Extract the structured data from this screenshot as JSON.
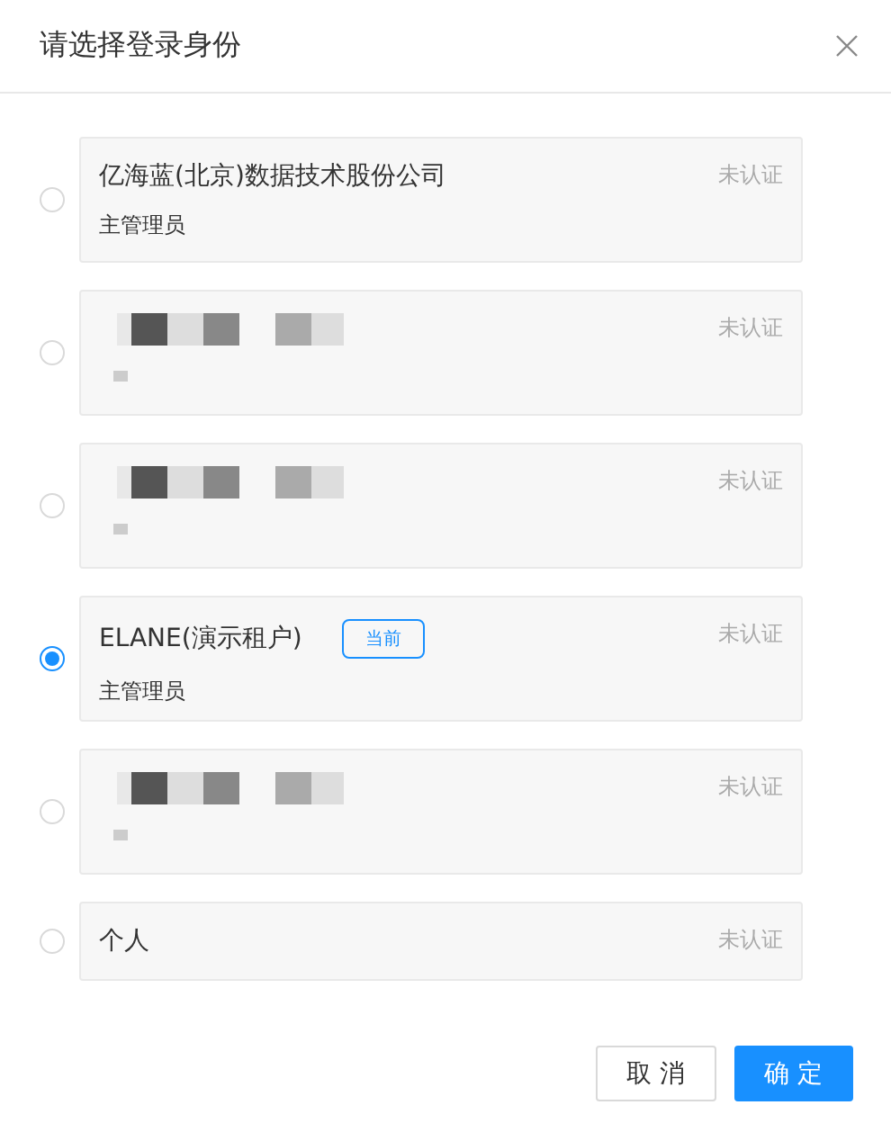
{
  "dialog": {
    "title": "请选择登录身份"
  },
  "identities": [
    {
      "kind": "detailed",
      "name": "亿海蓝(北京)数据技术股份公司",
      "role": "主管理员",
      "status": "未认证",
      "selected": false
    },
    {
      "kind": "redacted",
      "status": "未认证",
      "selected": false
    },
    {
      "kind": "redacted",
      "status": "未认证",
      "selected": false
    },
    {
      "kind": "detailed",
      "name": "ELANE(演示租户)",
      "badge": "当前",
      "role": "主管理员",
      "status": "未认证",
      "selected": true
    },
    {
      "kind": "redacted",
      "status": "未认证",
      "selected": false
    },
    {
      "kind": "simple",
      "name": "个人",
      "status": "未认证",
      "selected": false
    }
  ],
  "buttons": [
    {
      "kind": "secondary",
      "label": "取 消"
    },
    {
      "kind": "primary",
      "label": "确 定"
    }
  ]
}
